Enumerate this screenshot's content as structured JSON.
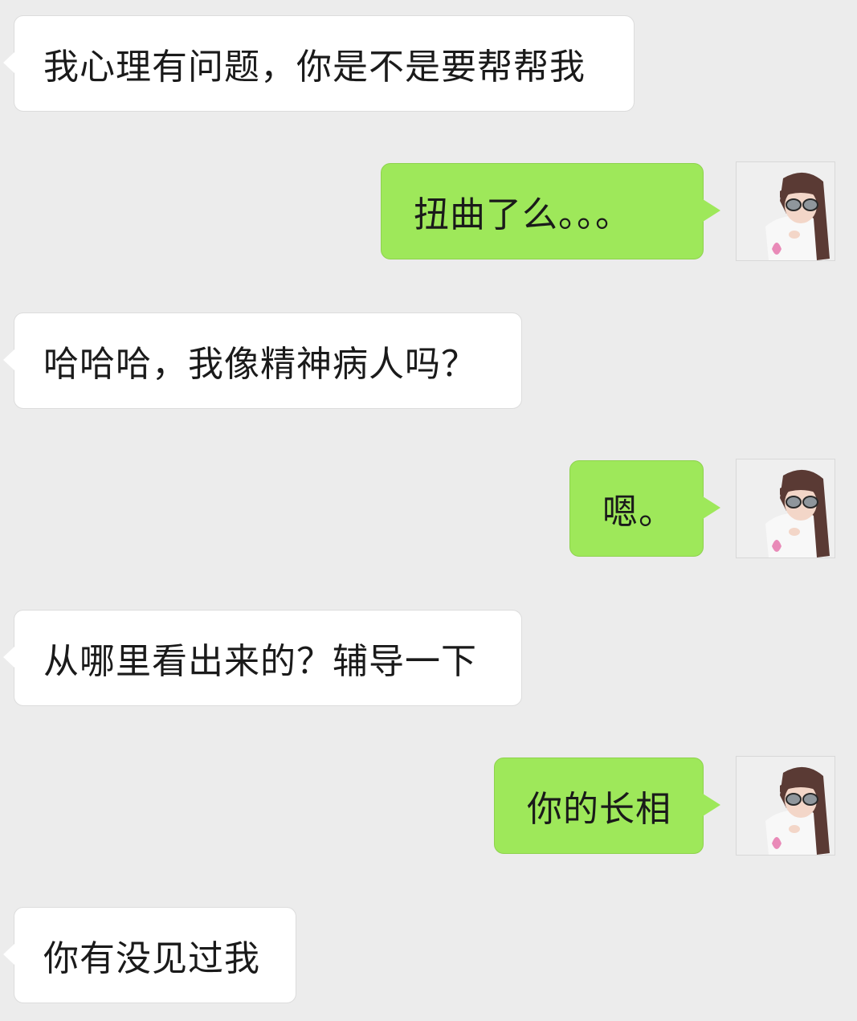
{
  "chat": {
    "messages": [
      {
        "side": "incoming",
        "text": "我心理有问题，你是不是要帮帮我"
      },
      {
        "side": "outgoing",
        "text": "扭曲了么。。。",
        "avatar": "user-avatar"
      },
      {
        "side": "incoming",
        "text": "哈哈哈，我像精神病人吗？"
      },
      {
        "side": "outgoing",
        "text": "嗯。",
        "avatar": "user-avatar"
      },
      {
        "side": "incoming",
        "text": "从哪里看出来的？辅导一下"
      },
      {
        "side": "outgoing",
        "text": "你的长相",
        "avatar": "user-avatar"
      },
      {
        "side": "incoming",
        "text": "你有没见过我"
      }
    ]
  },
  "colors": {
    "background": "#ececec",
    "incoming_bubble": "#ffffff",
    "outgoing_bubble": "#9ee85a",
    "text": "#1a1a1a"
  }
}
